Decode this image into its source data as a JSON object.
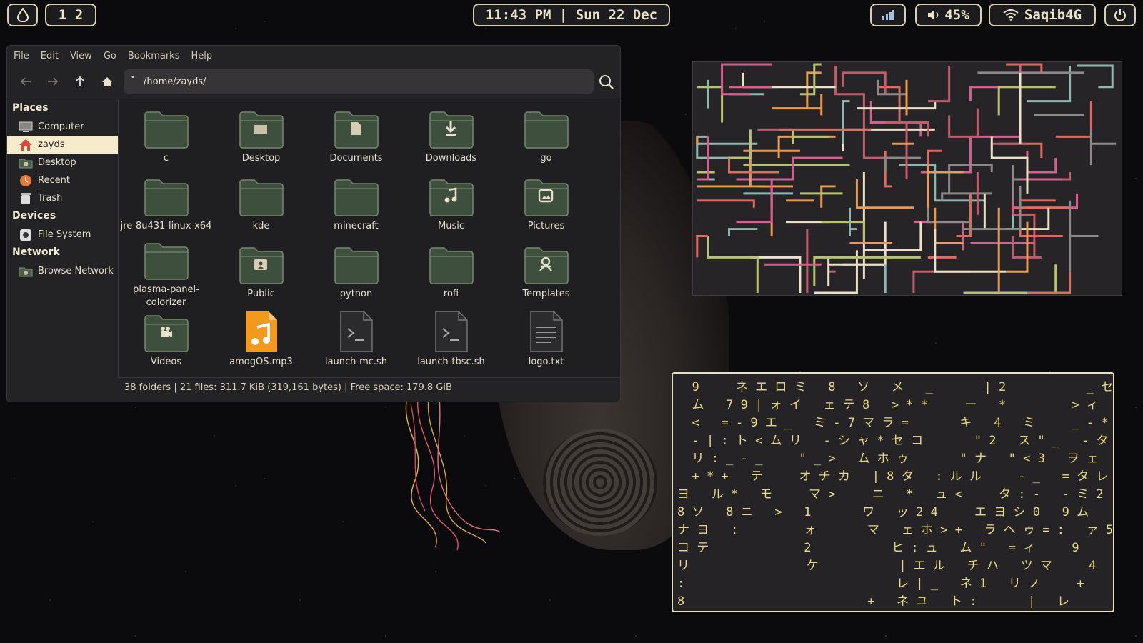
{
  "topbar": {
    "workspaces": "1 2",
    "clock": "11:43 PM | Sun 22 Dec",
    "volume": "45%",
    "wifi_name": "Saqib4G",
    "icons": [
      "droplet-icon",
      "signal-bars-icon",
      "speaker-icon",
      "wifi-icon",
      "power-icon"
    ]
  },
  "file_manager": {
    "menu": [
      "File",
      "Edit",
      "View",
      "Go",
      "Bookmarks",
      "Help"
    ],
    "path": "/home/zayds/",
    "sidebar": {
      "places_heading": "Places",
      "places": [
        {
          "label": "Computer",
          "icon": "computer-icon"
        },
        {
          "label": "zayds",
          "icon": "home-icon",
          "selected": true
        },
        {
          "label": "Desktop",
          "icon": "desktop-icon"
        },
        {
          "label": "Recent",
          "icon": "recent-icon"
        },
        {
          "label": "Trash",
          "icon": "trash-icon"
        }
      ],
      "devices_heading": "Devices",
      "devices": [
        {
          "label": "File System",
          "icon": "disk-icon"
        }
      ],
      "network_heading": "Network",
      "network": [
        {
          "label": "Browse Network",
          "icon": "network-icon"
        }
      ]
    },
    "items": [
      {
        "label": "c",
        "icon": "folder"
      },
      {
        "label": "Desktop",
        "icon": "folder-desktop"
      },
      {
        "label": "Documents",
        "icon": "folder-documents"
      },
      {
        "label": "Downloads",
        "icon": "folder-downloads"
      },
      {
        "label": "go",
        "icon": "folder"
      },
      {
        "label": "jre-8u431-linux-x64",
        "icon": "folder"
      },
      {
        "label": "kde",
        "icon": "folder"
      },
      {
        "label": "minecraft",
        "icon": "folder"
      },
      {
        "label": "Music",
        "icon": "folder-music"
      },
      {
        "label": "Pictures",
        "icon": "folder-pictures"
      },
      {
        "label": "plasma-panel-colorizer",
        "icon": "folder"
      },
      {
        "label": "Public",
        "icon": "folder-public"
      },
      {
        "label": "python",
        "icon": "folder"
      },
      {
        "label": "rofi",
        "icon": "folder"
      },
      {
        "label": "Templates",
        "icon": "folder-templates"
      },
      {
        "label": "Videos",
        "icon": "folder-videos"
      },
      {
        "label": "amogOS.mp3",
        "icon": "audio-file"
      },
      {
        "label": "launch-mc.sh",
        "icon": "script-file"
      },
      {
        "label": "launch-tbsc.sh",
        "icon": "script-file"
      },
      {
        "label": "logo.txt",
        "icon": "text-file"
      }
    ],
    "status": "38 folders  |  21 files: 311.7 KiB (319,161 bytes)  |  Free space: 179.8 GiB"
  },
  "matrix": {
    "rows": [
      "  9     ネ エ ロ ミ   8   ソ   メ   _       | 2           _ セ",
      "  ム   7 9 | ォ イ   ェ テ 8   > * *     ー   *         > ィ",
      "  <   = - 9 エ _   ミ - 7 マ ラ =       キ   4   ミ     _ - *",
      "  - | : ト < ム リ   - シ ャ * セ コ       \" 2   ス \" _   - タ ク",
      "  リ : _ - _     \" _ >   ム ホ ゥ       \" ナ   \" < 3   ヲ ェ",
      "  + * +   テ     オ チ カ   | 8 タ   : ル ル     - _   = タ レ",
      "ヨ   ル *   モ     マ >     ニ   *   ュ <     タ : -   - ミ 2",
      "8 ソ   8 ニ   >   1       ワ   ッ 2 4     エ ヨ シ 0   9 ム",
      "ナ ヨ   :         ォ       マ   ェ ホ > +   ラ ヘ ゥ = :   ァ 5",
      "コ テ             2           ヒ : ュ   ム \"   = ィ     9",
      "リ                ケ           | エ ル   チ ハ   ツ マ     4",
      ":                             レ | _   ネ 1   リ ノ     +",
      "8                         +   ネ ユ   ト :       |   レ"
    ]
  }
}
